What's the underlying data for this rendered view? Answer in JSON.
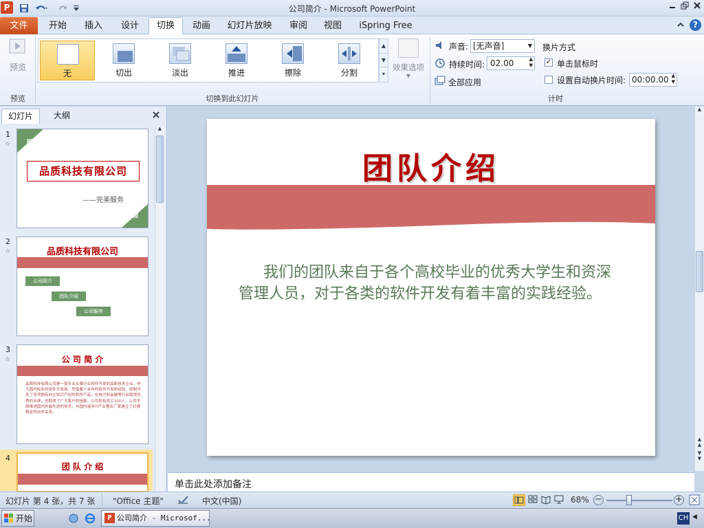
{
  "window": {
    "title": "公司简介 - Microsoft PowerPoint",
    "app_icon": "P"
  },
  "tabs": {
    "file": "文件",
    "items": [
      "开始",
      "插入",
      "设计",
      "切换",
      "动画",
      "幻灯片放映",
      "审阅",
      "视图",
      "iSpring Free"
    ],
    "active_index": 3
  },
  "ribbon": {
    "preview": {
      "button": "预览",
      "group": "预览"
    },
    "transitions": {
      "items": [
        "无",
        "切出",
        "淡出",
        "推进",
        "擦除",
        "分割"
      ],
      "selected_index": 0,
      "group": "切换到此幻灯片"
    },
    "effect_options": "效果选项",
    "timing": {
      "sound_label": "声音:",
      "sound_value": "[无声音]",
      "duration_label": "持续时间:",
      "duration_value": "02.00",
      "apply_all": "全部应用",
      "advance_title": "换片方式",
      "on_click_label": "单击鼠标时",
      "on_click_checked": true,
      "auto_label": "设置自动换片时间:",
      "auto_value": "00:00.00",
      "auto_checked": false,
      "group": "计时"
    }
  },
  "slides_panel": {
    "tabs": [
      "幻灯片",
      "大纲"
    ],
    "slides": [
      {
        "num": "1",
        "title": "品质科技有限公司",
        "sub": "——完美服务"
      },
      {
        "num": "2",
        "title": "品质科技有限公司",
        "boxes": [
          "公司简介",
          "团队介绍",
          "公司服务"
        ]
      },
      {
        "num": "3",
        "title": "公 司 简 介",
        "body": "品质科技有限公司是一家专业从事行业软件开发的高新技术企业，作为国内知名的软件开发商，凭借着十余年的软件开发的经验，研制开发了多项拥有自主知识产权的软件产品；在电力和金融等行业取得优秀的业绩，也取得了广大客户的信赖。公司现有员工100人，公司不断推进国内外最先进的技术，与国内诸多IT产业著名厂家建立了长期稳定的伙伴关系。"
      },
      {
        "num": "4",
        "title": "团 队 介 绍"
      }
    ]
  },
  "slide": {
    "title": "团队介绍",
    "body": "我们的团队来自于各个高校毕业的优秀大学生和资深管理人员，对于各类的软件开发有着丰富的实践经验。"
  },
  "notes_placeholder": "单击此处添加备注",
  "status": {
    "slide_info": "幻灯片 第 4 张，共 7 张",
    "theme": "\"Office 主题\"",
    "language": "中文(中国)",
    "zoom": "68%",
    "zoom_fraction": 0.68
  },
  "taskbar": {
    "start": "开始",
    "task": "公司简介 - Microsof...",
    "ime": "CH"
  },
  "colors": {
    "accent_red": "#cd6a68",
    "title_red": "#b40000",
    "body_green": "#5a7a58",
    "thumb_green": "#6c9966"
  }
}
